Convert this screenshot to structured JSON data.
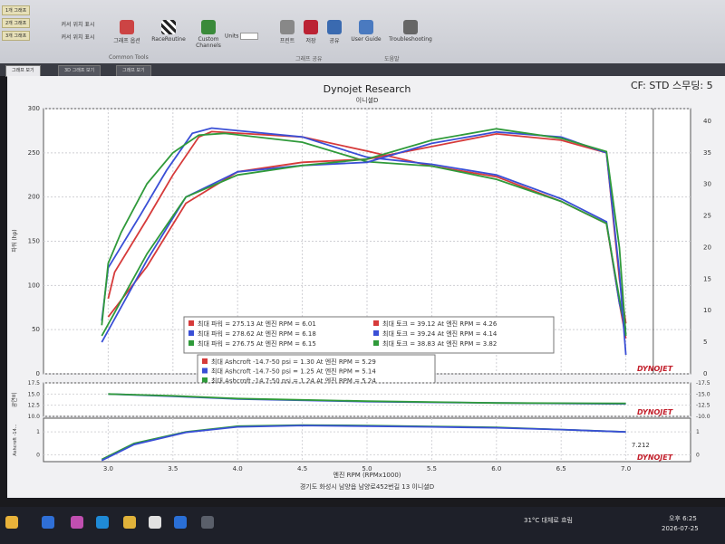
{
  "ribbon": {
    "quick_items": [
      "1개 그래프",
      "2개 그래프",
      "3개 그래프"
    ],
    "buttons": [
      "커서 위치 표시",
      "커서 위치 표시",
      "그래프 옵션",
      "RaceRoutine",
      "Custom Channels",
      "Units",
      "프린트",
      "저장",
      "공유",
      "User Guide",
      "Troubleshooting"
    ],
    "groups": [
      "Common Tools",
      "그래프 공유",
      "도움말"
    ]
  },
  "tabs": [
    "그래프 보기",
    "3D 그래프 보기",
    "그래프 보기"
  ],
  "header": {
    "title": "Dynojet Research",
    "subtitle": "이니셜D",
    "cf": "CF: STD 스무딩: 5"
  },
  "footer": "경기도 화성시 남양읍 남양로452번길 13 이니셜D",
  "taskbar": {
    "weather": "31°C 대체로 흐림",
    "time": "오후 6:25",
    "date": "2026-07-25"
  },
  "chart_data": [
    {
      "type": "line",
      "name": "main",
      "xlim": [
        2.5,
        7.5
      ],
      "ylim_left": [
        0,
        300
      ],
      "ylim_right": [
        0,
        42
      ],
      "ylabel": "파워 (hp)",
      "y_ticks_left": [
        0,
        50,
        100,
        150,
        200,
        250,
        300
      ],
      "y_ticks_right": [
        0,
        5,
        10,
        15,
        20,
        25,
        30,
        35,
        40
      ],
      "grid": true,
      "colors": [
        "#d63a3a",
        "#3a4fd6",
        "#2f9a3a"
      ],
      "power_series": [
        {
          "color": "#d63a3a",
          "x": [
            3.0,
            3.05,
            3.3,
            3.5,
            3.7,
            3.8,
            4.5,
            5.0,
            5.5,
            6.0,
            6.5,
            6.85,
            6.95,
            7.0
          ],
          "y": [
            85,
            115,
            175,
            225,
            268,
            274,
            268,
            252,
            235,
            223,
            195,
            170,
            80,
            40
          ]
        },
        {
          "color": "#3a4fd6",
          "x": [
            2.95,
            3.0,
            3.25,
            3.45,
            3.65,
            3.8,
            4.5,
            5.0,
            5.5,
            6.0,
            6.5,
            6.85,
            6.95,
            7.0
          ],
          "y": [
            60,
            120,
            180,
            230,
            272,
            278,
            268,
            245,
            237,
            225,
            198,
            172,
            80,
            50
          ]
        },
        {
          "color": "#2f9a3a",
          "x": [
            2.95,
            3.0,
            3.1,
            3.3,
            3.5,
            3.7,
            3.9,
            4.5,
            5.0,
            5.5,
            6.0,
            6.5,
            6.85,
            6.95,
            7.0
          ],
          "y": [
            55,
            125,
            160,
            215,
            250,
            270,
            272,
            262,
            240,
            235,
            220,
            195,
            170,
            85,
            45
          ]
        }
      ],
      "torque_series": [
        {
          "color": "#d63a3a",
          "x": [
            3.0,
            3.3,
            3.6,
            4.0,
            4.5,
            5.0,
            5.5,
            6.0,
            6.5,
            6.85,
            6.95,
            7.0
          ],
          "y": [
            9,
            17,
            27,
            32,
            33.5,
            34,
            36,
            38,
            37,
            35,
            15,
            8
          ]
        },
        {
          "color": "#3a4fd6",
          "x": [
            2.95,
            3.3,
            3.6,
            4.0,
            4.5,
            5.0,
            5.5,
            6.0,
            6.5,
            6.85,
            6.95,
            7.0
          ],
          "y": [
            5,
            18,
            28,
            32,
            33,
            33.5,
            36.5,
            38.3,
            37.5,
            35,
            16,
            3
          ]
        },
        {
          "color": "#2f9a3a",
          "x": [
            2.95,
            3.3,
            3.6,
            4.0,
            4.5,
            5.0,
            5.5,
            6.0,
            6.5,
            6.85,
            6.95,
            7.0
          ],
          "y": [
            6,
            19,
            28,
            31.5,
            33,
            34,
            37,
            38.8,
            37.3,
            35.2,
            20,
            6
          ]
        }
      ],
      "legend_rows": [
        {
          "color": "#d63a3a",
          "power": "최대 파워 = 275.13 At 엔진 RPM = 6.01",
          "torque": "최대 토크 = 39.12 At 엔진 RPM = 4.26"
        },
        {
          "color": "#3a4fd6",
          "power": "최대 파워 = 278.62 At 엔진 RPM = 6.18",
          "torque": "최대 토크 = 39.24 At 엔진 RPM = 4.14"
        },
        {
          "color": "#2f9a3a",
          "power": "최대 파워 = 276.75 At 엔진 RPM = 6.15",
          "torque": "최대 토크 = 38.83 At 엔진 RPM = 3.82"
        }
      ],
      "afr_rows": [
        {
          "color": "#d63a3a",
          "text": "최대 Ashcroft -14.7-50 psi = 1.30 At 엔진 RPM = 5.29"
        },
        {
          "color": "#3a4fd6",
          "text": "최대 Ashcroft -14.7-50 psi = 1.25 At 엔진 RPM = 5.14"
        },
        {
          "color": "#2f9a3a",
          "text": "최대 Ashcroft -14.7-50 psi = 1.24 At 엔진 RPM = 5.24"
        }
      ],
      "logo": "DYNOJET"
    },
    {
      "type": "line",
      "name": "afr",
      "ylabel": "공연비",
      "y_ticks": [
        10.0,
        12.5,
        15.0,
        17.5
      ],
      "ylim": [
        10,
        17.5
      ],
      "series": [
        {
          "color": "#3a4fd6",
          "x": [
            3.0,
            3.5,
            4.0,
            5.0,
            6.0,
            7.0
          ],
          "y": [
            15.0,
            14.5,
            13.9,
            13.3,
            13.0,
            12.8
          ]
        },
        {
          "color": "#2f9a3a",
          "x": [
            3.0,
            3.5,
            4.0,
            5.0,
            6.0,
            7.0
          ],
          "y": [
            15.0,
            14.6,
            14.0,
            13.4,
            13.0,
            12.9
          ]
        }
      ]
    },
    {
      "type": "line",
      "name": "boost",
      "ylabel": "Ashcroft -14...",
      "y_ticks": [
        0,
        1
      ],
      "ylim": [
        -0.3,
        1.6
      ],
      "x_ticks": [
        3.0,
        3.5,
        4.0,
        4.5,
        5.0,
        5.5,
        6.0,
        6.5,
        7.0
      ],
      "xlabel": "엔진 RPM (RPMx1000)",
      "cursor_label": "7.212",
      "series": [
        {
          "color": "#2f9a3a",
          "x": [
            2.95,
            3.2,
            3.6,
            4.0,
            4.5,
            5.0,
            5.5,
            6.0,
            6.5,
            7.0
          ],
          "y": [
            -0.2,
            0.5,
            1.0,
            1.25,
            1.3,
            1.28,
            1.24,
            1.2,
            1.1,
            1.0
          ]
        },
        {
          "color": "#3a4fd6",
          "x": [
            2.95,
            3.2,
            3.6,
            4.0,
            4.5,
            5.0,
            5.5,
            6.0,
            6.5,
            7.0
          ],
          "y": [
            -0.25,
            0.45,
            0.98,
            1.22,
            1.28,
            1.25,
            1.22,
            1.18,
            1.1,
            1.0
          ]
        }
      ]
    }
  ]
}
